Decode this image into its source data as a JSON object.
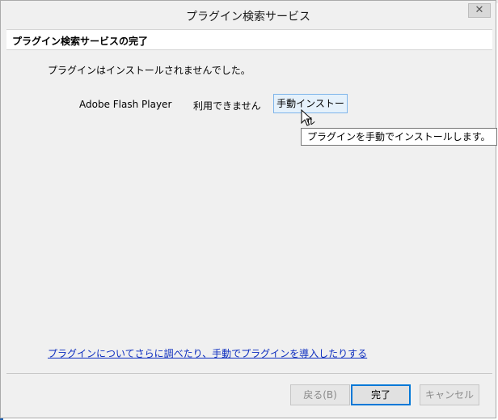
{
  "window": {
    "title": "プラグイン検索サービス",
    "close_glyph": "✕"
  },
  "header": {
    "title": "プラグイン検索サービスの完了"
  },
  "content": {
    "status_message": "プラグインはインストールされませんでした。",
    "plugin": {
      "name": "Adobe Flash Player",
      "status": "利用できません",
      "manual_install_label": "手動インストール"
    },
    "tooltip": "プラグインを手動でインストールします。",
    "more_info_link": "プラグインについてさらに調べたり、手動でプラグインを導入したりする"
  },
  "footer": {
    "back_label": "戻る(B)",
    "finish_label": "完了",
    "cancel_label": "キャンセル"
  },
  "colors": {
    "link": "#0c2dbf",
    "accent": "#0078d7",
    "button_hover": "#e5f1fb"
  }
}
